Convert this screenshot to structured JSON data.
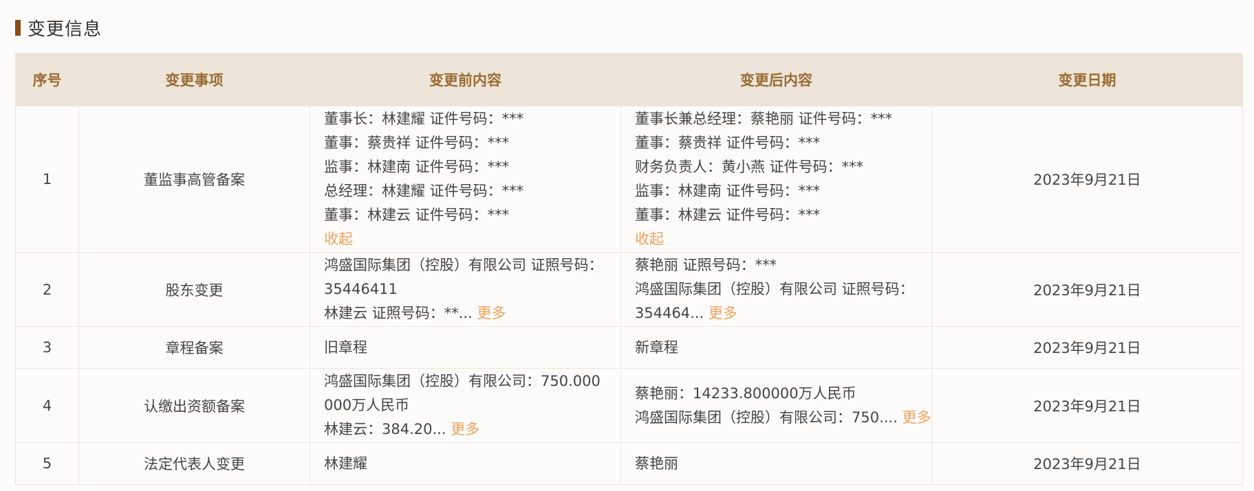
{
  "section": {
    "title": "变更信息"
  },
  "table": {
    "headers": [
      "序号",
      "变更事项",
      "变更前内容",
      "变更后内容",
      "变更日期"
    ],
    "rows": [
      {
        "no": "1",
        "item": "董监事高管备案",
        "before": [
          "董事长：林建耀 证件号码：***",
          "董事：蔡贵祥 证件号码：***",
          "监事：林建南 证件号码：***",
          "总经理：林建耀 证件号码：***",
          "董事：林建云 证件号码：***"
        ],
        "before_link": "收起",
        "after": [
          "董事长兼总经理：蔡艳丽 证件号码：***",
          "董事：蔡贵祥 证件号码：***",
          "财务负责人：黄小燕 证件号码：***",
          "监事：林建南 证件号码：***",
          "董事：林建云 证件号码：***"
        ],
        "after_link": "收起",
        "date": "2023年9月21日"
      },
      {
        "no": "2",
        "item": "股东变更",
        "before": [
          "鸿盛国际集团（控股）有限公司 证照号码：35446411",
          "林建云 证照号码：**..."
        ],
        "before_link": "更多",
        "after": [
          "蔡艳丽 证照号码：***",
          "鸿盛国际集团（控股）有限公司 证照号码：354464..."
        ],
        "after_link": "更多",
        "date": "2023年9月21日"
      },
      {
        "no": "3",
        "item": "章程备案",
        "before": [
          "旧章程"
        ],
        "after": [
          "新章程"
        ],
        "date": "2023年9月21日"
      },
      {
        "no": "4",
        "item": "认缴出资额备案",
        "before": [
          "鸿盛国际集团（控股）有限公司：750.000000万人民币",
          "林建云：384.20..."
        ],
        "before_link": "更多",
        "after": [
          "蔡艳丽：14233.800000万人民币",
          "鸿盛国际集团（控股）有限公司：750...."
        ],
        "after_link": "更多",
        "date": "2023年9月21日"
      },
      {
        "no": "5",
        "item": "法定代表人变更",
        "before": [
          "林建耀"
        ],
        "after": [
          "蔡艳丽"
        ],
        "date": "2023年9月21日"
      }
    ]
  },
  "colors": {
    "accent_bar": "#8b4a17",
    "header_bg": "#ede5d9",
    "header_text": "#9a6b32",
    "link": "#f5a05a"
  }
}
